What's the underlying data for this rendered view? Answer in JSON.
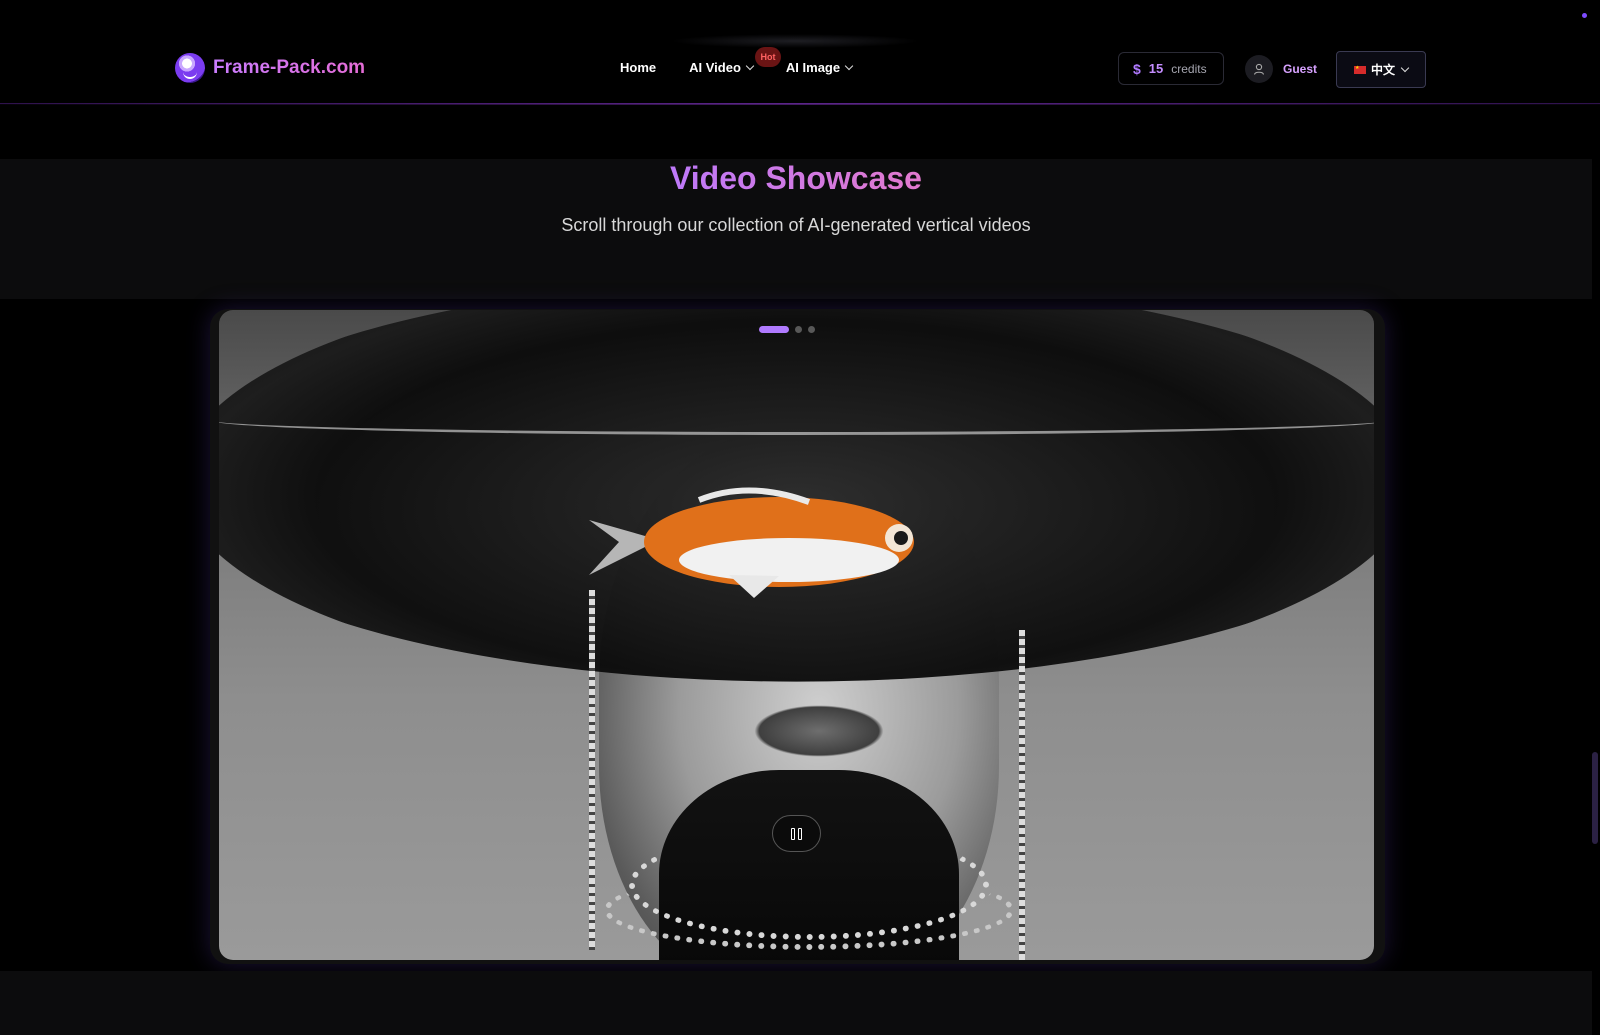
{
  "header": {
    "brand": "Frame-Pack.com",
    "nav": [
      {
        "label": "Home"
      },
      {
        "label": "AI Video",
        "badge": "Hot"
      },
      {
        "label": "AI Image"
      }
    ],
    "credits": {
      "icon": "dollar-icon",
      "amount": "15",
      "label": "credits"
    },
    "user": {
      "icon": "user-icon",
      "name": "Guest"
    },
    "language": {
      "icon": "china-flag-icon",
      "label": "中文"
    }
  },
  "showcase": {
    "title": "Video Showcase",
    "subtitle": "Scroll through our collection of AI-generated vertical videos",
    "slides_total": 3,
    "active_slide": 1,
    "playback_icon": "pause-icon"
  },
  "colors": {
    "accent": "#b07aff",
    "accent_pink": "#e56cd6",
    "background": "#000000"
  }
}
